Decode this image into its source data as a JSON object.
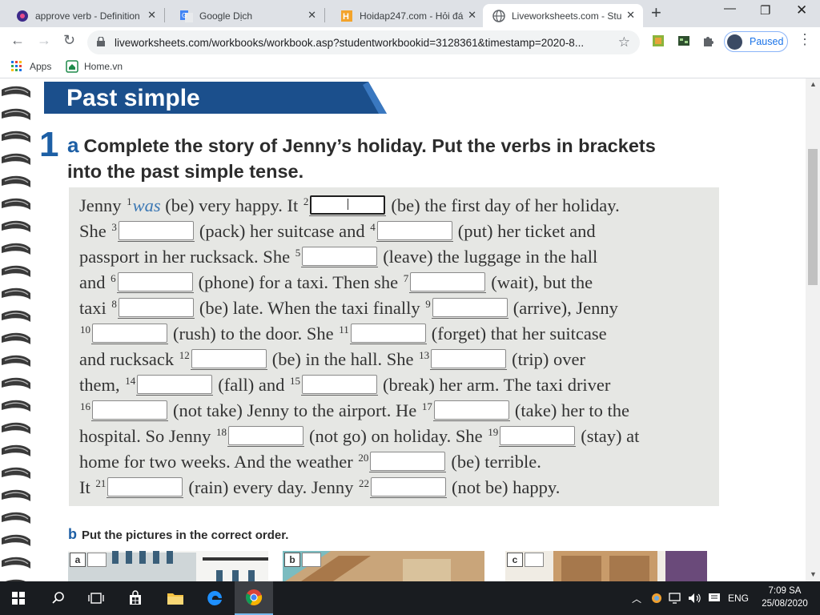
{
  "browser": {
    "tabs": [
      {
        "title": "approve verb - Definition",
        "active": false
      },
      {
        "title": "Google Dịch",
        "active": false
      },
      {
        "title": "Hoidap247.com - Hỏi đáp",
        "active": false
      },
      {
        "title": "Liveworksheets.com - Stu",
        "active": true
      }
    ],
    "url": "liveworksheets.com/workbooks/workbook.asp?studentworkbookid=3128361&timestamp=2020-8...",
    "profile_status": "Paused",
    "bookmarks": [
      {
        "label": "Apps",
        "icon": "apps-grid-icon"
      },
      {
        "label": "Home.vn",
        "icon": "homevn-icon"
      }
    ]
  },
  "worksheet": {
    "section_title": "Past simple",
    "exercise_number": "1",
    "part_a_letter": "a",
    "instruction_line1": "Complete the story of Jenny’s holiday. Put the verbs in brackets",
    "instruction_line2": "into the past simple tense.",
    "answers": {
      "1": "was"
    },
    "part_b_letter": "b",
    "part_b_instruction": "Put the pictures in the correct order.",
    "picture_labels": [
      "a",
      "b",
      "c"
    ]
  },
  "taskbar": {
    "language": "ENG",
    "time": "7:09 SA",
    "date": "25/08/2020"
  }
}
